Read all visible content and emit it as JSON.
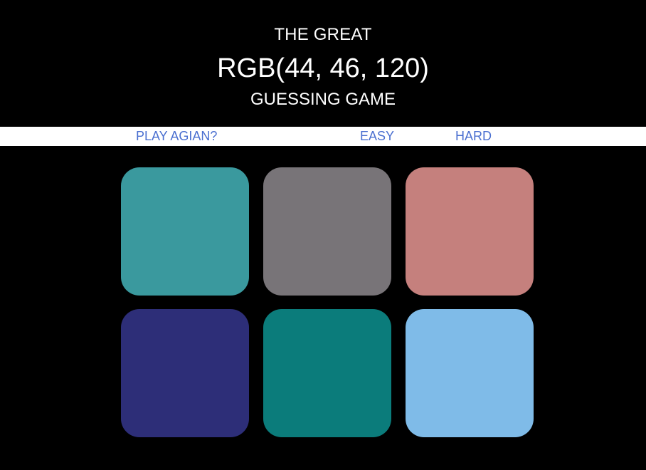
{
  "header": {
    "title_top": "THE GREAT",
    "rgb_display": "RGB(44, 46, 120)",
    "title_bottom": "GUESSING GAME"
  },
  "controls": {
    "reset_label": "PLAY AGIAN?",
    "easy_label": "EASY",
    "hard_label": "HARD"
  },
  "squares": [
    {
      "color": "#3a999e"
    },
    {
      "color": "#787478"
    },
    {
      "color": "#c5807d"
    },
    {
      "color": "#2d2e78"
    },
    {
      "color": "#0b7c7b"
    },
    {
      "color": "#7fbbe8"
    }
  ],
  "colors": {
    "background": "#000000",
    "header_text": "#ffffff",
    "stripe": "#ffffff",
    "control_text": "#4a6fd0"
  }
}
